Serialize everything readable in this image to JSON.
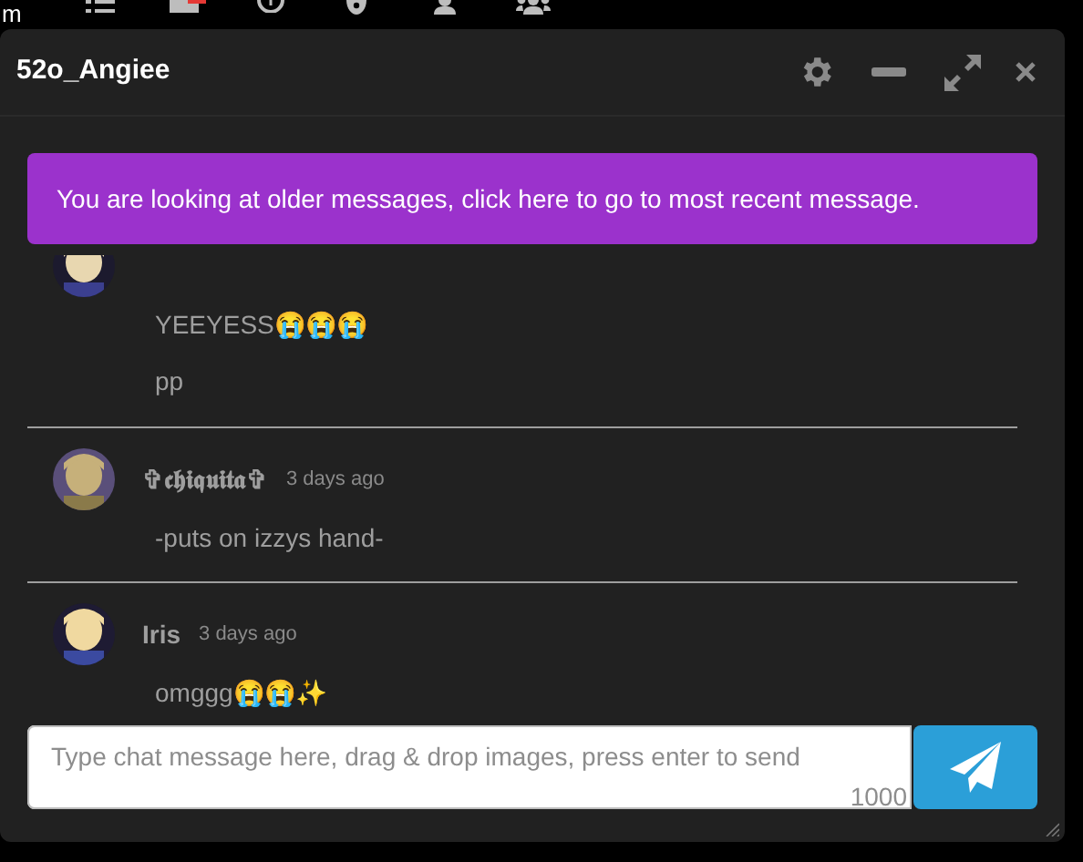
{
  "top_nav": {
    "brand_fragment": "m"
  },
  "window": {
    "title": "52o_Angiee"
  },
  "banner": {
    "text": "You are looking at older messages, click here to go to most recent message."
  },
  "messages": [
    {
      "lines": [
        "YEEYESS😭😭😭",
        "pp"
      ]
    },
    {
      "name": "✞𝖈𝖍𝖎𝖖𝖚𝖎𝖙𝖆✞",
      "time": "3 days ago",
      "lines": [
        "-puts on izzys hand-"
      ]
    },
    {
      "name": "Iris",
      "time": "3 days ago",
      "lines": [
        "omggg😭😭✨"
      ]
    }
  ],
  "composer": {
    "placeholder": "Type chat message here, drag & drop images, press enter to send",
    "counter": "1000"
  }
}
